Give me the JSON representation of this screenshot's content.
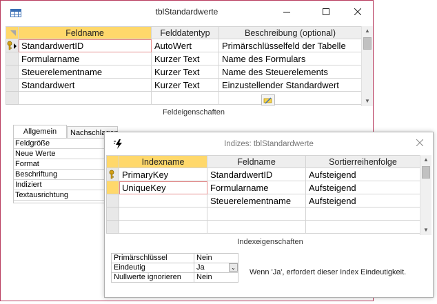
{
  "table_window": {
    "title": "tblStandardwerte",
    "grid": {
      "columns": [
        "Feldname",
        "Felddatentyp",
        "Beschreibung (optional)"
      ],
      "rows": [
        {
          "primary_key": true,
          "cells": [
            "StandardwertID",
            "AutoWert",
            "Primärschlüsselfeld der Tabelle"
          ]
        },
        {
          "primary_key": false,
          "cells": [
            "Formularname",
            "Kurzer Text",
            "Name des Formulars"
          ]
        },
        {
          "primary_key": false,
          "cells": [
            "Steuerelementname",
            "Kurzer Text",
            "Name des Steuerelements"
          ]
        },
        {
          "primary_key": false,
          "cells": [
            "Standardwert",
            "Kurzer Text",
            "Einzustellender Standardwert"
          ]
        },
        {
          "primary_key": false,
          "cells": [
            "",
            "",
            ""
          ]
        }
      ]
    },
    "field_properties_label": "Feldeigenschaften",
    "tabs": [
      "Allgemein",
      "Nachschlagen"
    ],
    "properties": [
      "Feldgröße",
      "Neue Werte",
      "Format",
      "Beschriftung",
      "Indiziert",
      "Textausrichtung"
    ]
  },
  "index_window": {
    "title": "Indizes: tblStandardwerte",
    "grid": {
      "columns": [
        "Indexname",
        "Feldname",
        "Sortierreihenfolge"
      ],
      "rows": [
        {
          "primary_key": true,
          "cells": [
            "PrimaryKey",
            "StandardwertID",
            "Aufsteigend"
          ]
        },
        {
          "primary_key": false,
          "cells": [
            "UniqueKey",
            "Formularname",
            "Aufsteigend"
          ]
        },
        {
          "primary_key": false,
          "cells": [
            "",
            "Steuerelementname",
            "Aufsteigend"
          ]
        },
        {
          "primary_key": false,
          "cells": [
            "",
            "",
            ""
          ]
        },
        {
          "primary_key": false,
          "cells": [
            "",
            "",
            ""
          ]
        }
      ]
    },
    "index_properties_label": "Indexeigenschaften",
    "properties": [
      {
        "label": "Primärschlüssel",
        "value": "Nein"
      },
      {
        "label": "Eindeutig",
        "value": "Ja"
      },
      {
        "label": "Nullwerte ignorieren",
        "value": "Nein"
      }
    ],
    "hint": "Wenn 'Ja', erfordert dieser Index Eindeutigkeit."
  },
  "colors": {
    "accent_header": "#ffd86b",
    "window_border": "#b83b5e",
    "key_icon": "#d4a017"
  }
}
